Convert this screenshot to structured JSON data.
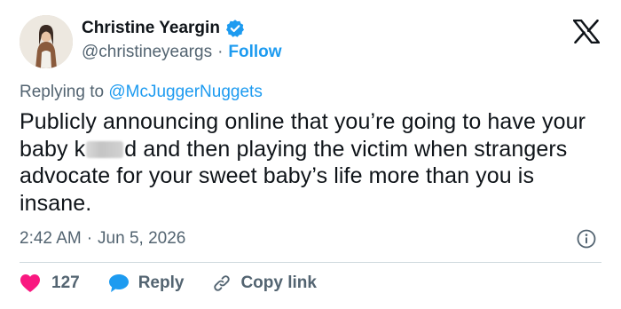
{
  "author": {
    "display_name": "Christine Yeargin",
    "handle": "@christineyeargs",
    "separator": "·",
    "follow_label": "Follow",
    "verified": true,
    "verified_color": "#1d9bf0"
  },
  "reply": {
    "prefix": "Replying to",
    "mention": "@McJuggerNuggets"
  },
  "tweet": {
    "text_before": "Publicly announcing online that you’re going to have your baby k",
    "text_after": "d and then playing the victim when strangers advocate for your sweet baby’s life more than you is insane."
  },
  "meta": {
    "time": "2:42 AM",
    "separator": "·",
    "date": "Jun 5, 2026"
  },
  "actions": {
    "like_count": "127",
    "reply_label": "Reply",
    "copy_link_label": "Copy link"
  },
  "colors": {
    "accent": "#1d9bf0",
    "like": "#f91880",
    "text": "#0f1419",
    "secondary": "#536471"
  },
  "icons": {
    "platform": "x-logo-icon",
    "info": "info-icon",
    "like": "heart-icon",
    "reply": "speech-bubble-icon",
    "copy": "link-icon"
  }
}
